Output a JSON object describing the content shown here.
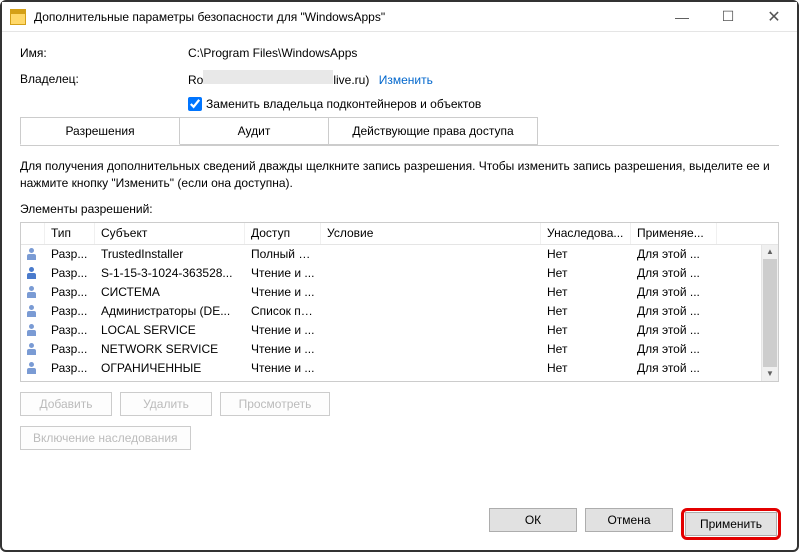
{
  "titlebar": {
    "title": "Дополнительные параметры безопасности  для \"WindowsApps\""
  },
  "fields": {
    "name_label": "Имя:",
    "name_value": "C:\\Program Files\\WindowsApps",
    "owner_label": "Владелец:",
    "owner_prefix": "Ro",
    "owner_suffix": "live.ru)",
    "change_link": "Изменить",
    "replace_owner_label": "Заменить владельца подконтейнеров и объектов"
  },
  "tabs": {
    "permissions": "Разрешения",
    "audit": "Аудит",
    "effective": "Действующие права доступа"
  },
  "instructions": "Для получения дополнительных сведений дважды щелкните запись разрешения. Чтобы изменить запись разрешения, выделите ее и нажмите кнопку \"Изменить\" (если она доступна).",
  "elements_label": "Элементы разрешений:",
  "columns": {
    "type": "Тип",
    "subject": "Субъект",
    "access": "Доступ",
    "condition": "Условие",
    "inherited": "Унаследова...",
    "applies": "Применяе..."
  },
  "rows": [
    {
      "type": "Разр...",
      "subject": "TrustedInstaller",
      "access": "Полный д...",
      "inherited": "Нет",
      "applies": "Для этой ..."
    },
    {
      "type": "Разр...",
      "subject": "S-1-15-3-1024-363528...",
      "access": "Чтение и ...",
      "inherited": "Нет",
      "applies": "Для этой ...",
      "sid": true
    },
    {
      "type": "Разр...",
      "subject": "СИСТЕМА",
      "access": "Чтение и ...",
      "inherited": "Нет",
      "applies": "Для этой ..."
    },
    {
      "type": "Разр...",
      "subject": "Администраторы (DE...",
      "access": "Список па...",
      "inherited": "Нет",
      "applies": "Для этой ..."
    },
    {
      "type": "Разр...",
      "subject": "LOCAL SERVICE",
      "access": "Чтение и ...",
      "inherited": "Нет",
      "applies": "Для этой ..."
    },
    {
      "type": "Разр...",
      "subject": "NETWORK SERVICE",
      "access": "Чтение и ...",
      "inherited": "Нет",
      "applies": "Для этой ..."
    },
    {
      "type": "Разр...",
      "subject": "ОГРАНИЧЕННЫЕ",
      "access": "Чтение и ...",
      "inherited": "Нет",
      "applies": "Для этой ..."
    }
  ],
  "buttons": {
    "add": "Добавить",
    "remove": "Удалить",
    "view": "Просмотреть",
    "enable_inherit": "Включение наследования",
    "ok": "ОК",
    "cancel": "Отмена",
    "apply": "Применить"
  }
}
